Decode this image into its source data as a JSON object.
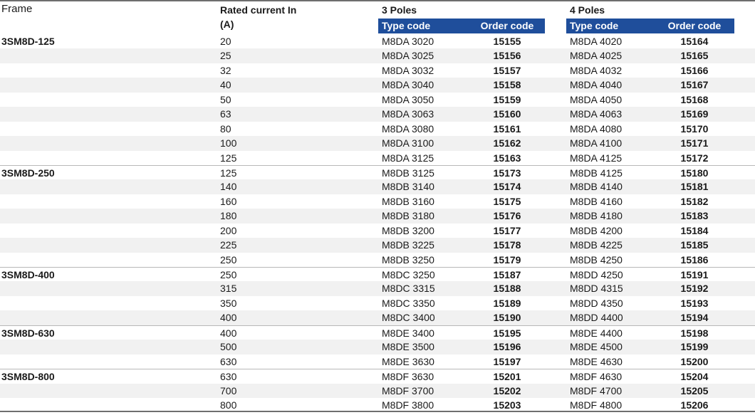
{
  "header": {
    "frame_label": "Frame",
    "rated_label_line1": "Rated current In",
    "rated_label_line2": "(A)",
    "poles3_label": "3 Poles",
    "poles4_label": "4 Poles",
    "type_code_label": "Type code",
    "order_code_label": "Order code"
  },
  "colors": {
    "header_bar": "#1f4e9b",
    "row_shade": "#f1f1f1",
    "rule": "#6e6e6e"
  },
  "rows": [
    {
      "frame": "3SM8D-125",
      "rated": "20",
      "type3": "M8DA 3020",
      "order3": "15155",
      "type4": "M8DA 4020",
      "order4": "15164"
    },
    {
      "frame": "",
      "rated": "25",
      "type3": "M8DA 3025",
      "order3": "15156",
      "type4": "M8DA 4025",
      "order4": "15165"
    },
    {
      "frame": "",
      "rated": "32",
      "type3": "M8DA 3032",
      "order3": "15157",
      "type4": "M8DA 4032",
      "order4": "15166"
    },
    {
      "frame": "",
      "rated": "40",
      "type3": "M8DA 3040",
      "order3": "15158",
      "type4": "M8DA 4040",
      "order4": "15167"
    },
    {
      "frame": "",
      "rated": "50",
      "type3": "M8DA 3050",
      "order3": "15159",
      "type4": "M8DA 4050",
      "order4": "15168"
    },
    {
      "frame": "",
      "rated": "63",
      "type3": "M8DA 3063",
      "order3": "15160",
      "type4": "M8DA 4063",
      "order4": "15169"
    },
    {
      "frame": "",
      "rated": "80",
      "type3": "M8DA 3080",
      "order3": "15161",
      "type4": "M8DA 4080",
      "order4": "15170"
    },
    {
      "frame": "",
      "rated": "100",
      "type3": "M8DA 3100",
      "order3": "15162",
      "type4": "M8DA 4100",
      "order4": "15171"
    },
    {
      "frame": "",
      "rated": "125",
      "type3": "M8DA 3125",
      "order3": "15163",
      "type4": "M8DA 4125",
      "order4": "15172"
    },
    {
      "frame": "3SM8D-250",
      "rated": "125",
      "type3": "M8DB 3125",
      "order3": "15173",
      "type4": "M8DB 4125",
      "order4": "15180"
    },
    {
      "frame": "",
      "rated": "140",
      "type3": "M8DB 3140",
      "order3": "15174",
      "type4": "M8DB 4140",
      "order4": "15181"
    },
    {
      "frame": "",
      "rated": "160",
      "type3": "M8DB 3160",
      "order3": "15175",
      "type4": "M8DB 4160",
      "order4": "15182"
    },
    {
      "frame": "",
      "rated": "180",
      "type3": "M8DB 3180",
      "order3": "15176",
      "type4": "M8DB 4180",
      "order4": "15183"
    },
    {
      "frame": "",
      "rated": "200",
      "type3": "M8DB 3200",
      "order3": "15177",
      "type4": "M8DB 4200",
      "order4": "15184"
    },
    {
      "frame": "",
      "rated": "225",
      "type3": "M8DB 3225",
      "order3": "15178",
      "type4": "M8DB 4225",
      "order4": "15185"
    },
    {
      "frame": "",
      "rated": "250",
      "type3": "M8DB 3250",
      "order3": "15179",
      "type4": "M8DB 4250",
      "order4": "15186"
    },
    {
      "frame": "3SM8D-400",
      "rated": "250",
      "type3": "M8DC 3250",
      "order3": "15187",
      "type4": "M8DD 4250",
      "order4": "15191"
    },
    {
      "frame": "",
      "rated": "315",
      "type3": "M8DC 3315",
      "order3": "15188",
      "type4": "M8DD 4315",
      "order4": "15192"
    },
    {
      "frame": "",
      "rated": "350",
      "type3": "M8DC 3350",
      "order3": "15189",
      "type4": "M8DD 4350",
      "order4": "15193"
    },
    {
      "frame": "",
      "rated": "400",
      "type3": "M8DC 3400",
      "order3": "15190",
      "type4": "M8DD 4400",
      "order4": "15194"
    },
    {
      "frame": "3SM8D-630",
      "rated": "400",
      "type3": "M8DE 3400",
      "order3": "15195",
      "type4": "M8DE 4400",
      "order4": "15198"
    },
    {
      "frame": "",
      "rated": "500",
      "type3": "M8DE 3500",
      "order3": "15196",
      "type4": "M8DE 4500",
      "order4": "15199"
    },
    {
      "frame": "",
      "rated": "630",
      "type3": "M8DE 3630",
      "order3": "15197",
      "type4": "M8DE 4630",
      "order4": "15200"
    },
    {
      "frame": "3SM8D-800",
      "rated": "630",
      "type3": "M8DF 3630",
      "order3": "15201",
      "type4": "M8DF 4630",
      "order4": "15204"
    },
    {
      "frame": "",
      "rated": "700",
      "type3": "M8DF 3700",
      "order3": "15202",
      "type4": "M8DF 4700",
      "order4": "15205"
    },
    {
      "frame": "",
      "rated": "800",
      "type3": "M8DF 3800",
      "order3": "15203",
      "type4": "M8DF 4800",
      "order4": "15206"
    }
  ]
}
